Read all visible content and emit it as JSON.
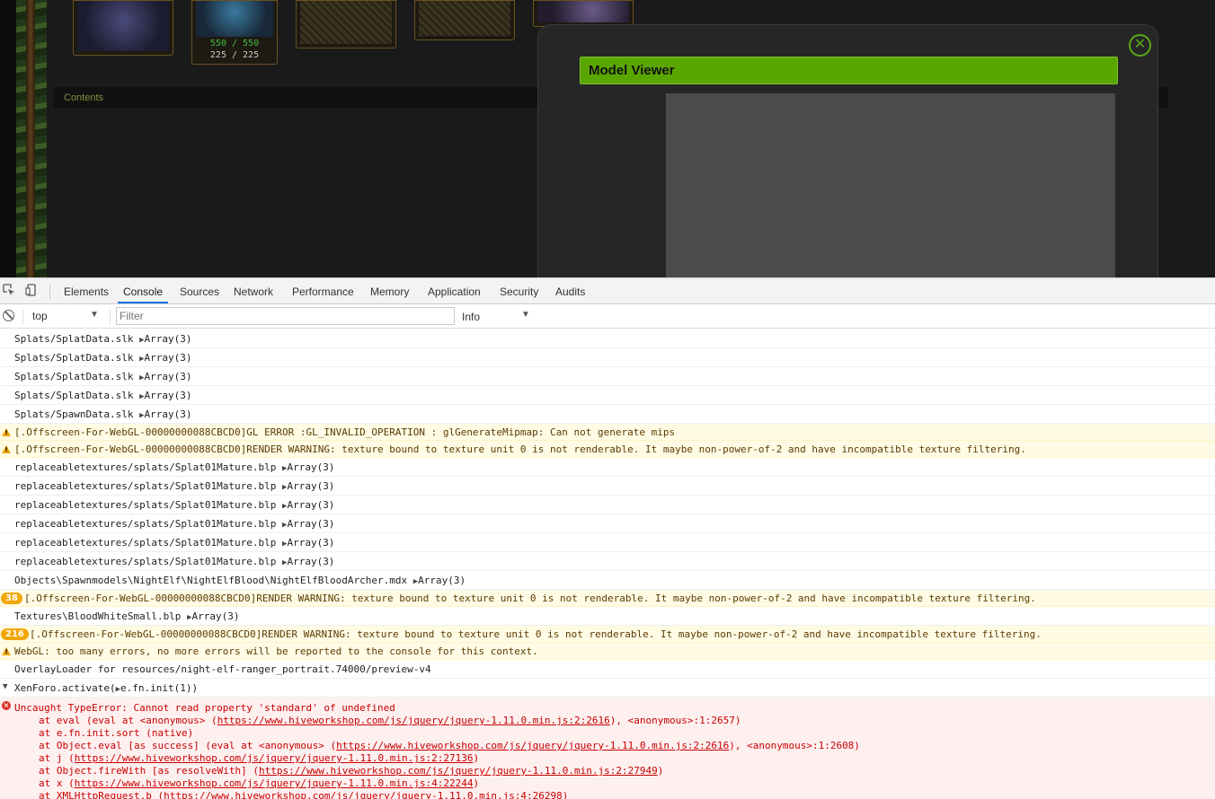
{
  "page": {
    "portraits": [
      {
        "name": "portrait-1"
      },
      {
        "name": "portrait-2",
        "hp": "550 / 550",
        "mana": "225 / 225"
      },
      {
        "name": "portrait-3"
      },
      {
        "name": "portrait-4"
      },
      {
        "name": "portrait-5"
      }
    ],
    "contents_label": "Contents"
  },
  "modal": {
    "title": "Model Viewer",
    "close_icon": "✕"
  },
  "devtools": {
    "tabs": [
      "Elements",
      "Console",
      "Sources",
      "Network",
      "Performance",
      "Memory",
      "Application",
      "Security",
      "Audits"
    ],
    "active_tab": "Console",
    "context": "top",
    "filter_placeholder": "Filter",
    "level": "Info"
  },
  "console": {
    "rows": [
      {
        "type": "log",
        "text": "Splats/SplatData.slk",
        "obj": "Array(3)"
      },
      {
        "type": "log",
        "text": "Splats/SplatData.slk",
        "obj": "Array(3)"
      },
      {
        "type": "log",
        "text": "Splats/SplatData.slk",
        "obj": "Array(3)"
      },
      {
        "type": "log",
        "text": "Splats/SplatData.slk",
        "obj": "Array(3)"
      },
      {
        "type": "log",
        "text": "Splats/SpawnData.slk",
        "obj": "Array(3)"
      },
      {
        "type": "warn",
        "text": "[.Offscreen-For-WebGL-00000000088CBCD0]GL ERROR :GL_INVALID_OPERATION : glGenerateMipmap: Can not generate mips"
      },
      {
        "type": "warn",
        "text": "[.Offscreen-For-WebGL-00000000088CBCD0]RENDER WARNING: texture bound to texture unit 0 is not renderable. It maybe non-power-of-2 and have incompatible texture filtering."
      },
      {
        "type": "log",
        "text": "replaceabletextures/splats/Splat01Mature.blp",
        "obj": "Array(3)"
      },
      {
        "type": "log",
        "text": "replaceabletextures/splats/Splat01Mature.blp",
        "obj": "Array(3)"
      },
      {
        "type": "log",
        "text": "replaceabletextures/splats/Splat01Mature.blp",
        "obj": "Array(3)"
      },
      {
        "type": "log",
        "text": "replaceabletextures/splats/Splat01Mature.blp",
        "obj": "Array(3)"
      },
      {
        "type": "log",
        "text": "replaceabletextures/splats/Splat01Mature.blp",
        "obj": "Array(3)"
      },
      {
        "type": "log",
        "text": "replaceabletextures/splats/Splat01Mature.blp",
        "obj": "Array(3)"
      },
      {
        "type": "log",
        "text": "Objects\\Spawnmodels\\NightElf\\NightElfBlood\\NightElfBloodArcher.mdx",
        "obj": "Array(3)"
      },
      {
        "type": "warn",
        "badge": "38",
        "text": "[.Offscreen-For-WebGL-00000000088CBCD0]RENDER WARNING: texture bound to texture unit 0 is not renderable. It maybe non-power-of-2 and have incompatible texture filtering."
      },
      {
        "type": "log",
        "text": "Textures\\BloodWhiteSmall.blp",
        "obj": "Array(3)"
      },
      {
        "type": "warn",
        "badge": "216",
        "text": "[.Offscreen-For-WebGL-00000000088CBCD0]RENDER WARNING: texture bound to texture unit 0 is not renderable. It maybe non-power-of-2 and have incompatible texture filtering."
      },
      {
        "type": "warn",
        "text": "WebGL: too many errors, no more errors will be reported to the console for this context."
      },
      {
        "type": "log",
        "text": "OverlayLoader for resources/night-elf-ranger_portrait.74000/preview-v4"
      },
      {
        "type": "group",
        "text": "XenForo.activate(",
        "obj": "e.fn.init(1)",
        "suffix": ")"
      }
    ],
    "error": {
      "message": "Uncaught TypeError: Cannot read property 'standard' of undefined",
      "stack": [
        {
          "pre": "at eval (eval at <anonymous> (",
          "link": "https://www.hiveworkshop.com/js/jquery/jquery-1.11.0.min.js:2:2616",
          "post": "), <anonymous>:1:2657)"
        },
        {
          "pre": "at e.fn.init.sort (native)",
          "link": "",
          "post": ""
        },
        {
          "pre": "at Object.eval [as success] (eval at <anonymous> (",
          "link": "https://www.hiveworkshop.com/js/jquery/jquery-1.11.0.min.js:2:2616",
          "post": "), <anonymous>:1:2608)"
        },
        {
          "pre": "at j (",
          "link": "https://www.hiveworkshop.com/js/jquery/jquery-1.11.0.min.js:2:27136",
          "post": ")"
        },
        {
          "pre": "at Object.fireWith [as resolveWith] (",
          "link": "https://www.hiveworkshop.com/js/jquery/jquery-1.11.0.min.js:2:27949",
          "post": ")"
        },
        {
          "pre": "at x (",
          "link": "https://www.hiveworkshop.com/js/jquery/jquery-1.11.0.min.js:4:22244",
          "post": ")"
        },
        {
          "pre": "at XMLHttpRequest.b (",
          "link": "https://www.hiveworkshop.com/js/jquery/jquery-1.11.0.min.js:4:26298",
          "post": ")"
        }
      ]
    }
  }
}
